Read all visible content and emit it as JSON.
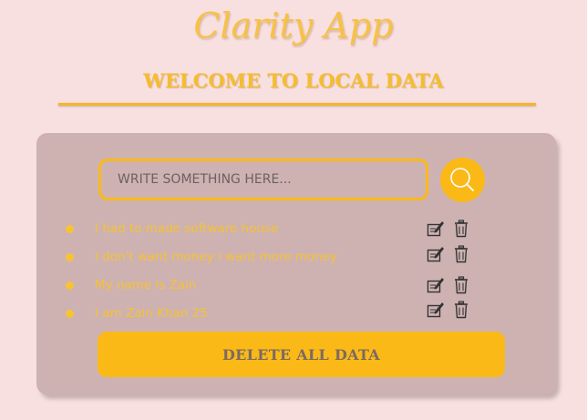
{
  "app": {
    "logo_text": "Clarity App",
    "headline": "WELCOME TO LOCAL DATA"
  },
  "search": {
    "placeholder": "WRITE SOMETHING HERE...",
    "value": ""
  },
  "items": [
    {
      "text": "I had to made software house"
    },
    {
      "text": "I don't want money i want more money"
    },
    {
      "text": "My name is Zain"
    },
    {
      "text": "I am Zain Khan 25"
    }
  ],
  "actions": {
    "delete_all_label": "DELETE ALL DATA"
  },
  "icons": {
    "search": "search-icon",
    "edit": "edit-icon",
    "delete": "trash-icon"
  },
  "colors": {
    "background": "#f8e0e0",
    "card": "#ceb2b2",
    "accent": "#fbb917",
    "text_accent": "#f5c232",
    "button_text": "#7a6a62"
  }
}
